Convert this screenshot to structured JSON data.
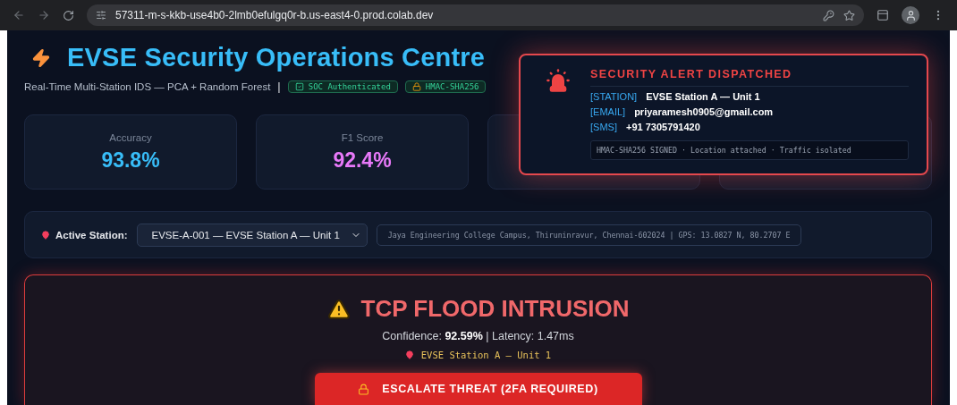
{
  "browser": {
    "url": "57311-m-s-kkb-use4b0-2lmb0efulgq0r-b.us-east4-0.prod.colab.dev"
  },
  "header": {
    "title": "EVSE Security Operations Centre",
    "subtitle": "Real-Time Multi-Station IDS — PCA + Random Forest",
    "separator": "|",
    "badges": [
      {
        "label": "SOC Authenticated",
        "kind": "check"
      },
      {
        "label": "HMAC-SHA256",
        "kind": "lock"
      }
    ]
  },
  "metrics": [
    {
      "kind": "metric",
      "label": "Accuracy",
      "value": "93.8%",
      "color": "#38bdf8"
    },
    {
      "kind": "metric",
      "label": "F1 Score",
      "value": "92.4%",
      "color": "#e879f9"
    },
    {
      "kind": "covered"
    },
    {
      "kind": "covered"
    }
  ],
  "station": {
    "label": "Active Station:",
    "selected_option": "EVSE-A-001 — EVSE Station A — Unit 1",
    "location": "Jaya Engineering College Campus, Thiruninravur, Chennai-602024 | GPS: 13.0827 N, 80.2707 E"
  },
  "threat": {
    "title": "TCP FLOOD INTRUSION",
    "details": "Confidence: **92.59%** | Latency: 1.47ms",
    "station": "EVSE Station A — Unit 1",
    "button": "ESCALATE THREAT (2FA REQUIRED)"
  },
  "alert": {
    "title": "SECURITY ALERT DISPATCHED",
    "fields": [
      {
        "tag": "[STATION]",
        "value": "EVSE Station A — Unit 1"
      },
      {
        "tag": "[EMAIL]",
        "value": "priyaramesh0905@gmail.com"
      },
      {
        "tag": "[SMS]",
        "value": "+91 7305791420"
      }
    ],
    "footer": "HMAC-SHA256 SIGNED · Location attached · Traffic isolated"
  }
}
